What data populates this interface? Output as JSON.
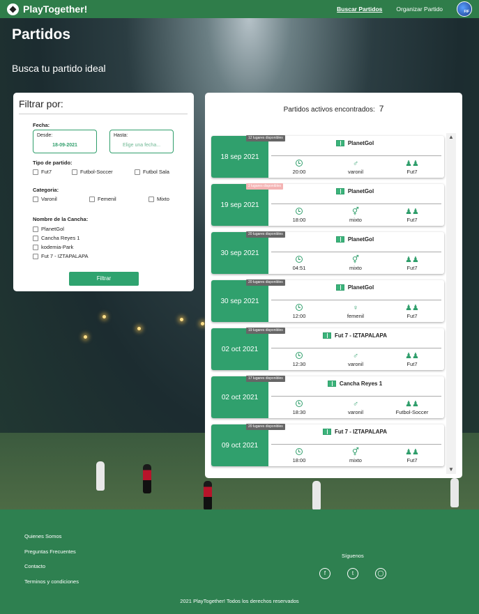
{
  "nav": {
    "brand": "PlayTogether!",
    "links": [
      "Buscar Partidos",
      "Organizar Partido"
    ],
    "avatar_text": "FIF"
  },
  "page": {
    "title": "Partidos",
    "subtitle": "Busca tu partido ideal"
  },
  "filter": {
    "heading": "Filtrar por:",
    "fecha_label": "Fecha:",
    "desde_label": "Desde:",
    "desde_value": "18-09-2021",
    "hasta_label": "Hasta:",
    "hasta_placeholder": "Elige una fecha...",
    "tipo_label": "Tipo de partido:",
    "tipos": [
      "Fut7",
      "Futbol-Soccer",
      "Futbol Sala"
    ],
    "categoria_label": "Categoria:",
    "categorias": [
      "Varonil",
      "Femenil",
      "Mixto"
    ],
    "cancha_label": "Nombre de la Cancha:",
    "canchas": [
      "PlanetGol",
      "Cancha Reyes 1",
      "kodemia-Park",
      "Fut 7 - IZTAPALAPA"
    ],
    "button": "Filtrar"
  },
  "results": {
    "count_label": "Partidos activos encontrados:",
    "count": "7",
    "matches": [
      {
        "date": "18 sep 2021",
        "badge": "12 lugares disponibles",
        "low": false,
        "field": "PlanetGol",
        "time": "20:00",
        "category": "varonil",
        "type": "Fut7"
      },
      {
        "date": "19 sep 2021",
        "badge": "2 lugares disponibles",
        "low": true,
        "field": "PlanetGol",
        "time": "18:00",
        "category": "mixto",
        "type": "Fut7"
      },
      {
        "date": "30 sep 2021",
        "badge": "20 lugares disponibles",
        "low": false,
        "field": "PlanetGol",
        "time": "04:51",
        "category": "mixto",
        "type": "Fut7"
      },
      {
        "date": "30 sep 2021",
        "badge": "20 lugares disponibles",
        "low": false,
        "field": "PlanetGol",
        "time": "12:00",
        "category": "femenil",
        "type": "Fut7"
      },
      {
        "date": "02 oct 2021",
        "badge": "19 lugares disponibles",
        "low": false,
        "field": "Fut 7 - IZTAPALAPA",
        "time": "12:30",
        "category": "varonil",
        "type": "Fut7"
      },
      {
        "date": "02 oct 2021",
        "badge": "17 lugares disponibles",
        "low": false,
        "field": "Cancha Reyes 1",
        "time": "18:30",
        "category": "varonil",
        "type": "Futbol-Soccer"
      },
      {
        "date": "09 oct 2021",
        "badge": "20 lugares disponibles",
        "low": false,
        "field": "Fut 7 - IZTAPALAPA",
        "time": "18:00",
        "category": "mixto",
        "type": "Fut7"
      }
    ]
  },
  "footer": {
    "links": [
      "Quienes Somos",
      "Preguntas Frecuentes",
      "Contacto",
      "Terminos y condiciones"
    ],
    "follow": "Síguenos",
    "social": [
      "facebook-icon",
      "twitter-icon",
      "instagram-icon"
    ],
    "copyright": "2021 PlayTogether! Todos los derechos reservados"
  },
  "colors": {
    "brand_green": "#2f7d4a",
    "accent_green": "#30a06d",
    "low_badge": "#f4b3b3"
  }
}
